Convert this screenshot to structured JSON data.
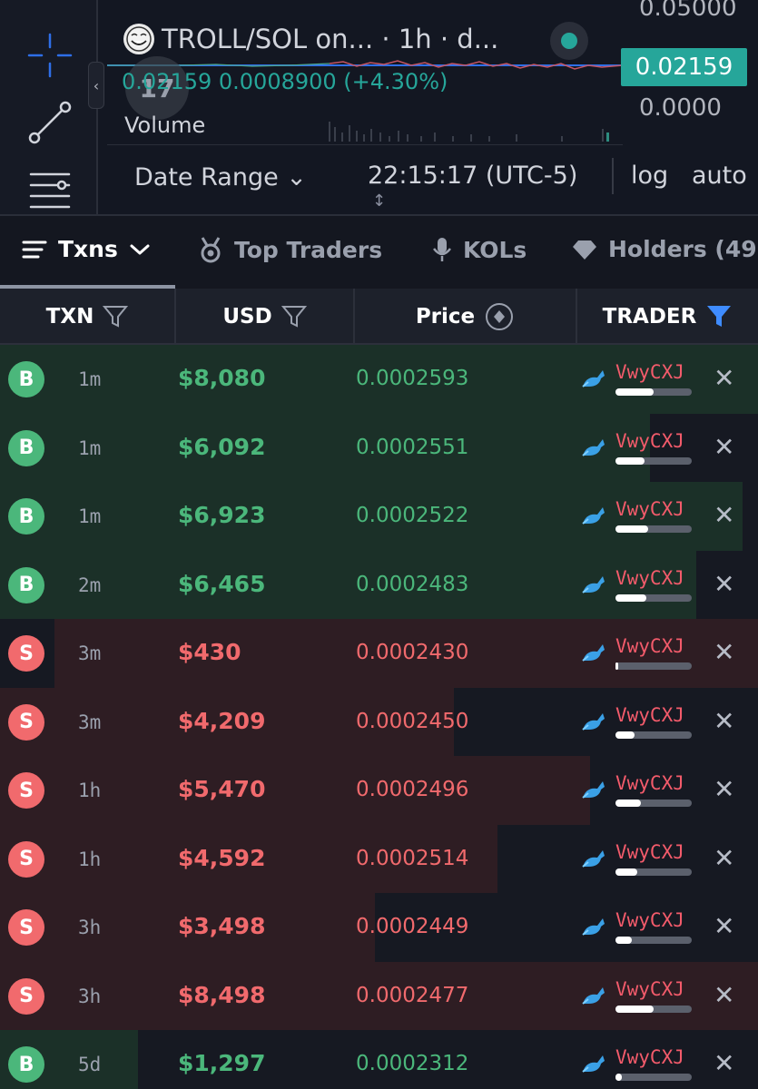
{
  "chart": {
    "title": "TROLL/SOL on... · 1h · d...",
    "ohlc_text": "0.02159 0.0008900 (+4.30%)",
    "bubble_text": "17",
    "volume_label": "Volume",
    "price_scale": {
      "top": "0.05000",
      "current": "0.02159",
      "bottom": "0.0000"
    },
    "date_range": "Date Range ⌄",
    "clock": "22:15:17 (UTC-5)",
    "log": "log",
    "auto": "auto",
    "collapse_glyph": "‹",
    "resize_glyph": "↕",
    "accent_color": "#26a69a",
    "icons": [
      "crosshair-icon",
      "trendline-icon",
      "indicators-icon",
      "troll-face-icon",
      "status-dot-icon"
    ]
  },
  "tabs": [
    {
      "label": "Txns",
      "icon": "list-icon",
      "active": true
    },
    {
      "label": "Top Traders",
      "icon": "medal-icon"
    },
    {
      "label": "KOLs",
      "icon": "microphone-icon"
    },
    {
      "label": "Holders (49",
      "icon": "diamond-icon"
    }
  ],
  "table": {
    "headers": {
      "txn": "TXN",
      "usd": "USD",
      "price": "Price",
      "trader": "TRADER"
    },
    "rows": [
      {
        "type": "B",
        "age": "1m",
        "usd": "$8,080",
        "price": "0.0002593",
        "trader": "VwyCXJ",
        "volume_fill": 1.0
      },
      {
        "type": "B",
        "age": "1m",
        "usd": "$6,092",
        "price": "0.0002551",
        "trader": "VwyCXJ",
        "volume_fill": 0.75
      },
      {
        "type": "B",
        "age": "1m",
        "usd": "$6,923",
        "price": "0.0002522",
        "trader": "VwyCXJ",
        "volume_fill": 0.85
      },
      {
        "type": "B",
        "age": "2m",
        "usd": "$6,465",
        "price": "0.0002483",
        "trader": "VwyCXJ",
        "volume_fill": 0.8
      },
      {
        "type": "S",
        "age": "3m",
        "usd": "$430",
        "price": "0.0002430",
        "trader": "VwyCXJ",
        "volume_fill": 0.07
      },
      {
        "type": "S",
        "age": "3m",
        "usd": "$4,209",
        "price": "0.0002450",
        "trader": "VwyCXJ",
        "volume_fill": 0.5
      },
      {
        "type": "S",
        "age": "1h",
        "usd": "$5,470",
        "price": "0.0002496",
        "trader": "VwyCXJ",
        "volume_fill": 0.65
      },
      {
        "type": "S",
        "age": "1h",
        "usd": "$4,592",
        "price": "0.0002514",
        "trader": "VwyCXJ",
        "volume_fill": 0.55
      },
      {
        "type": "S",
        "age": "3h",
        "usd": "$3,498",
        "price": "0.0002449",
        "trader": "VwyCXJ",
        "volume_fill": 0.43
      },
      {
        "type": "S",
        "age": "3h",
        "usd": "$8,498",
        "price": "0.0002477",
        "trader": "VwyCXJ",
        "volume_fill": 1.0
      },
      {
        "type": "B",
        "age": "5d",
        "usd": "$1,297",
        "price": "0.0002312",
        "trader": "VwyCXJ",
        "volume_fill": 0.15
      }
    ]
  },
  "colors": {
    "buy": "#4bb77b",
    "sell": "#f16a6d",
    "buy_bg": "#1b3028",
    "sell_bg": "#2e1d23",
    "trader_text": "#f35b6b",
    "filter_active": "#3f8cff"
  }
}
